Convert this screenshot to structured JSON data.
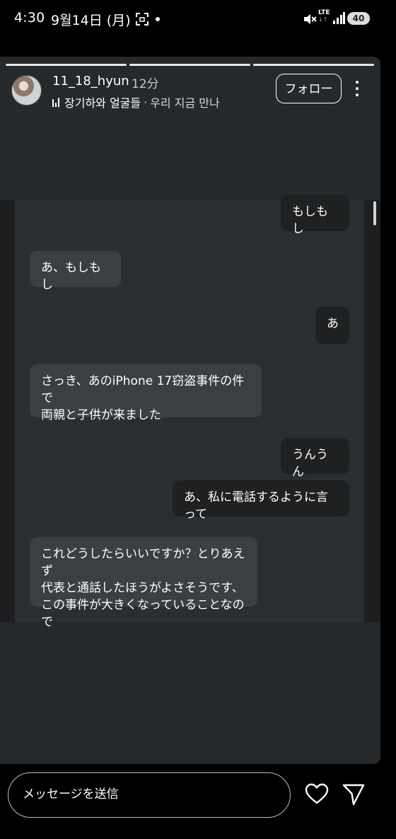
{
  "status_bar": {
    "time": "4:30",
    "date": "9월14日 (月)",
    "network": "LTE",
    "network_sub": "↓↑",
    "battery": "40"
  },
  "story": {
    "username": "11_18_hyun",
    "time_ago": "12分",
    "music_artist": "장기하와 얼굴들",
    "music_separator": "·",
    "music_song": "우리 지금 만나",
    "follow_label": "フォロー",
    "progress_segments": 3,
    "active_segment": 1
  },
  "chat": {
    "messages": [
      {
        "side": "sent",
        "text": "もしもし"
      },
      {
        "side": "received",
        "text": "あ、もしもし"
      },
      {
        "side": "sent",
        "text": "あ"
      },
      {
        "side": "received",
        "text": "さっき、あのiPhone 17窃盗事件の件で\n両親と子供が来ました"
      },
      {
        "side": "sent",
        "text": "うんうん"
      },
      {
        "side": "sent",
        "text": "あ、私に電話するように言って"
      },
      {
        "side": "received",
        "text": "これどうしたらいいですか？とりあえず\n代表と通話したほうがよさそうです、\nこの事件が大きくなっていることなので"
      }
    ]
  },
  "bottom_bar": {
    "message_placeholder": "メッセージを送信"
  },
  "icons": {
    "like": "heart-icon",
    "share": "send-icon",
    "more": "more-icon"
  },
  "colors": {
    "story_bg": "#26292b",
    "bubble_received": "#3a3f43",
    "bubble_sent": "#1e2022"
  }
}
